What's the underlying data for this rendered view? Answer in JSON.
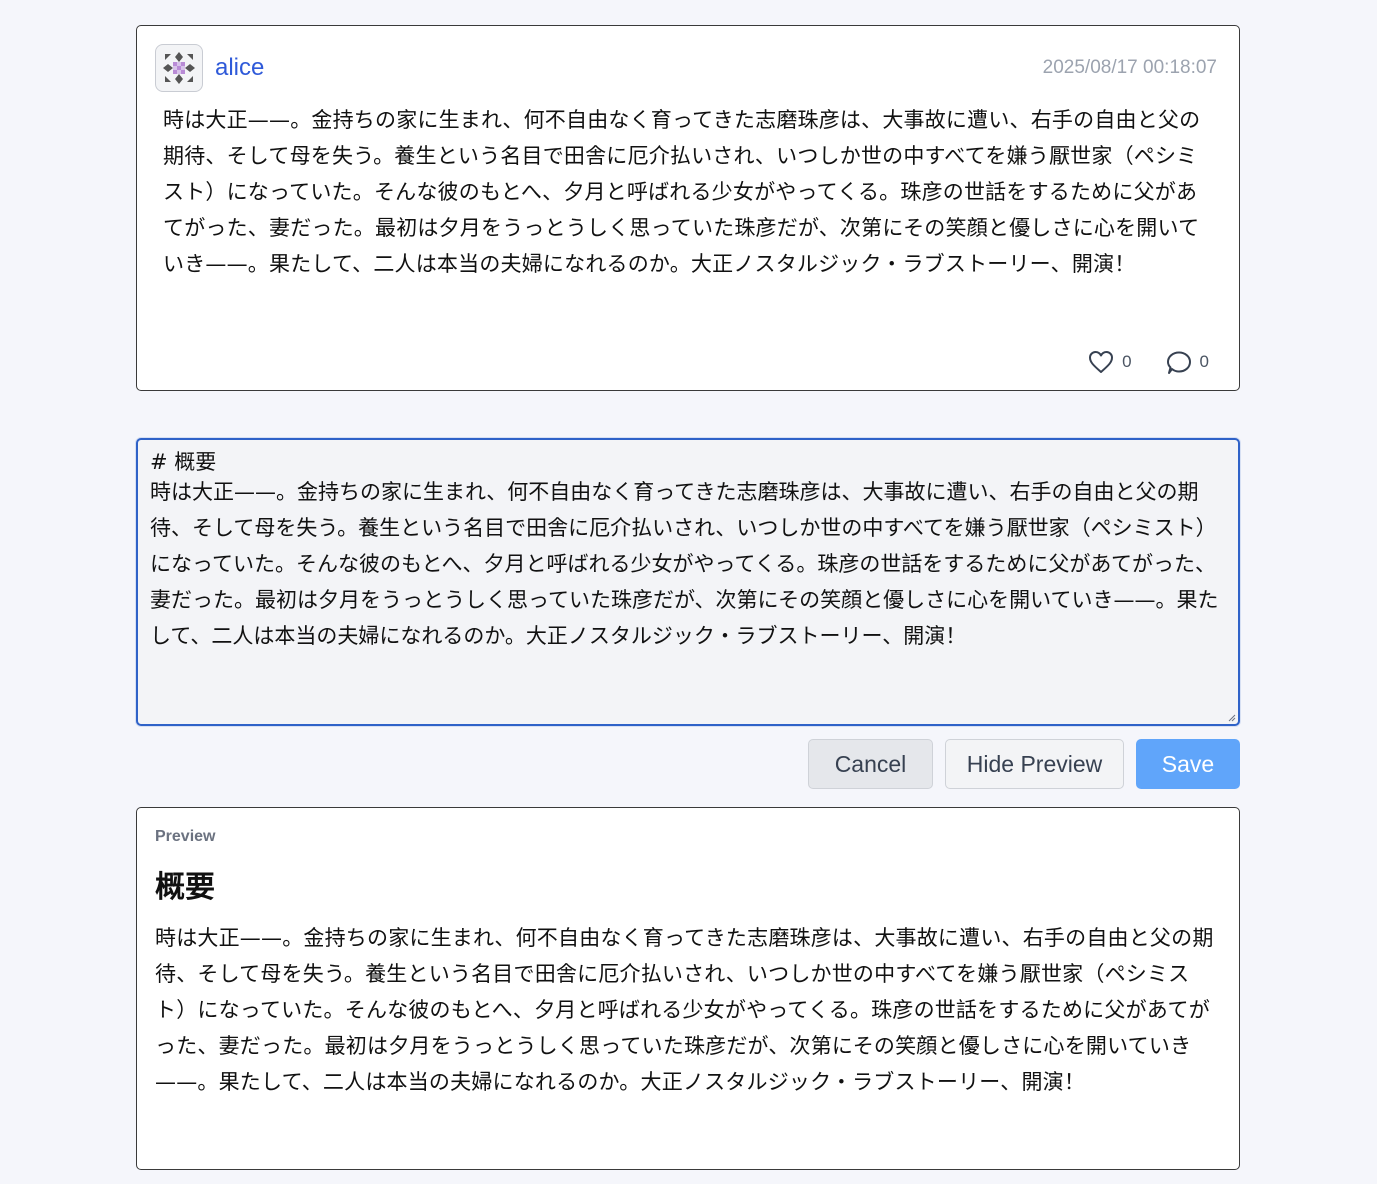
{
  "post": {
    "username": "alice",
    "timestamp": "2025/08/17 00:18:07",
    "body": "時は大正——。金持ちの家に生まれ、何不自由なく育ってきた志磨珠彦は、大事故に遭い、右手の自由と父の期待、そして母を失う。養生という名目で田舎に厄介払いされ、いつしか世の中すべてを嫌う厭世家（ペシミスト）になっていた。そんな彼のもとへ、夕月と呼ばれる少女がやってくる。珠彦の世話をするために父があてがった、妻だった。最初は夕月をうっとうしく思っていた珠彦だが、次第にその笑顔と優しさに心を開いていき——。果たして、二人は本当の夫婦になれるのか。大正ノスタルジック・ラブストーリー、開演！",
    "likes": "0",
    "comments": "0"
  },
  "editor": {
    "heading_line": "# 概要",
    "body": "時は大正——。金持ちの家に生まれ、何不自由なく育ってきた志磨珠彦は、大事故に遭い、右手の自由と父の期待、そして母を失う。養生という名目で田舎に厄介払いされ、いつしか世の中すべてを嫌う厭世家（ペシミスト）になっていた。そんな彼のもとへ、夕月と呼ばれる少女がやってくる。珠彦の世話をするために父があてがった、妻だった。最初は夕月をうっとうしく思っていた珠彦だが、次第にその笑顔と優しさに心を開いていき——。果たして、二人は本当の夫婦になれるのか。大正ノスタルジック・ラブストーリー、開演！"
  },
  "buttons": {
    "cancel": "Cancel",
    "hide_preview": "Hide Preview",
    "save": "Save"
  },
  "preview": {
    "label": "Preview",
    "title": "概要",
    "body": "時は大正——。金持ちの家に生まれ、何不自由なく育ってきた志磨珠彦は、大事故に遭い、右手の自由と父の期待、そして母を失う。養生という名目で田舎に厄介払いされ、いつしか世の中すべてを嫌う厭世家（ペシミスト）になっていた。そんな彼のもとへ、夕月と呼ばれる少女がやってくる。珠彦の世話をするために父があてがった、妻だった。最初は夕月をうっとうしく思っていた珠彦だが、次第にその笑顔と優しさに心を開いていき——。果たして、二人は本当の夫婦になれるのか。大正ノスタルジック・ラブストーリー、開演！"
  },
  "icons": {
    "avatar": "identicon-avatar",
    "like": "heart-icon",
    "comment": "comment-bubble-icon"
  },
  "colors": {
    "accent": "#2f5ad9",
    "editor_border": "#2f62c8",
    "save_button": "#60a5fa"
  }
}
